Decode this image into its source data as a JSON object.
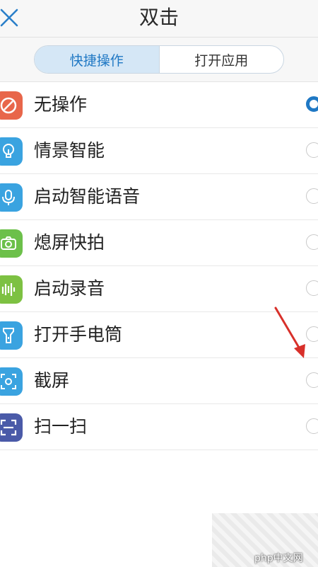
{
  "header": {
    "title": "双击",
    "close_icon": "close-icon"
  },
  "tabs": [
    {
      "label": "快捷操作",
      "active": true
    },
    {
      "label": "打开应用",
      "active": false
    }
  ],
  "options": [
    {
      "label": "无操作",
      "icon": "no-action-icon",
      "color": "#e8664a",
      "selected": true
    },
    {
      "label": "情景智能",
      "icon": "bulb-icon",
      "color": "#3aa3e0",
      "selected": false
    },
    {
      "label": "启动智能语音",
      "icon": "microphone-icon",
      "color": "#3aa3e0",
      "selected": false
    },
    {
      "label": "熄屏快拍",
      "icon": "camera-icon",
      "color": "#6cc04a",
      "selected": false
    },
    {
      "label": "启动录音",
      "icon": "audio-bars-icon",
      "color": "#7dc142",
      "selected": false
    },
    {
      "label": "打开手电筒",
      "icon": "flashlight-icon",
      "color": "#3aa3e0",
      "selected": false
    },
    {
      "label": "截屏",
      "icon": "screenshot-icon",
      "color": "#3aa3e0",
      "selected": false
    },
    {
      "label": "扫一扫",
      "icon": "scan-icon",
      "color": "#4a5aa8",
      "selected": false
    }
  ],
  "watermark": "php中文网",
  "colors": {
    "accent": "#1f78c4",
    "tab_active_bg": "#d5e7f6"
  }
}
